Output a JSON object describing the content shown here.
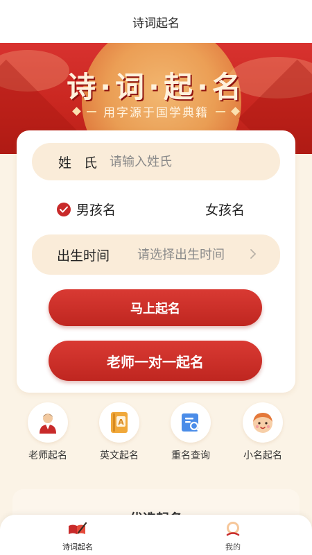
{
  "header": {
    "title": "诗词起名"
  },
  "banner": {
    "title": "诗·词·起·名",
    "subtitle": "用字源于国学典籍"
  },
  "form": {
    "surname_label": "姓 氏",
    "surname_placeholder": "请输入姓氏",
    "surname_value": "",
    "gender_boy": "男孩名",
    "gender_girl": "女孩名",
    "selected_gender": "boy",
    "birth_label": "出生时间",
    "birth_placeholder": "请选择出生时间",
    "name_now_button": "马上起名",
    "teacher_button": "老师一对一起名"
  },
  "features": [
    {
      "label": "老师起名",
      "icon": "teacher-icon"
    },
    {
      "label": "英文起名",
      "icon": "english-book-icon"
    },
    {
      "label": "重名查询",
      "icon": "search-doc-icon"
    },
    {
      "label": "小名起名",
      "icon": "child-face-icon"
    }
  ],
  "lower_section": {
    "title": "优选起名"
  },
  "tabbar": {
    "tabs": [
      {
        "label": "诗词起名",
        "icon": "poem-name-icon",
        "active": true
      },
      {
        "label": "我的",
        "icon": "profile-icon",
        "active": false
      }
    ]
  },
  "colors": {
    "accent": "#c82a2a",
    "banner": "#d8322f",
    "pill": "#faecd9",
    "background": "#fbf3e6"
  }
}
